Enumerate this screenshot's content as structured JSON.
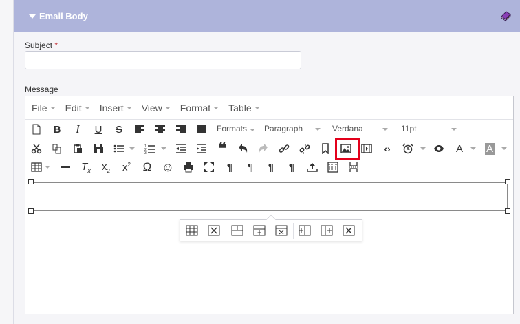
{
  "section": {
    "title": "Email Body",
    "book_icon": "book-icon"
  },
  "subject": {
    "label": "Subject",
    "required_mark": "*",
    "value": ""
  },
  "message": {
    "label": "Message"
  },
  "menubar": [
    "File",
    "Edit",
    "Insert",
    "View",
    "Format",
    "Table"
  ],
  "toolbar": {
    "formats": "Formats",
    "block": "Paragraph",
    "font": "Verdana",
    "size": "11pt",
    "bold": "B",
    "italic": "I",
    "underline": "U",
    "strike": "S",
    "omega": "Ω",
    "smiley": "☺"
  },
  "colors": {
    "header": "#aeb4db",
    "highlight": "#e3001b"
  },
  "highlighted_button": "insert-image-button"
}
